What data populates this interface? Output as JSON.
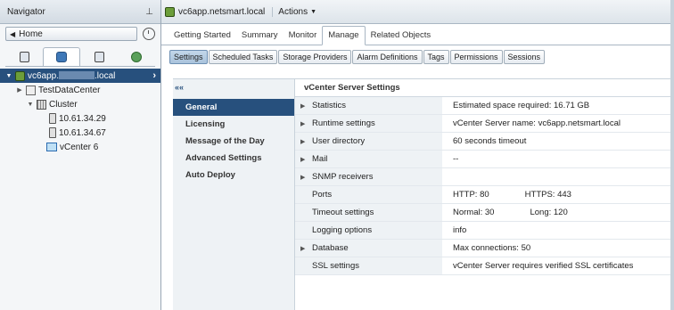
{
  "navigator": {
    "title": "Navigator",
    "home_label": "Home",
    "tree": [
      {
        "label": "vc6app.",
        "suffix": ".local",
        "selected": true
      },
      {
        "label": "TestDataCenter"
      },
      {
        "label": "Cluster"
      },
      {
        "label": "10.61.34.29"
      },
      {
        "label": "10.61.34.67"
      },
      {
        "label": "vCenter 6"
      }
    ]
  },
  "object": {
    "title": "vc6app.netsmart.local",
    "actions_label": "Actions"
  },
  "tabs": [
    "Getting Started",
    "Summary",
    "Monitor",
    "Manage",
    "Related Objects"
  ],
  "subtabs": [
    "Settings",
    "Scheduled Tasks",
    "Storage Providers",
    "Alarm Definitions",
    "Tags",
    "Permissions",
    "Sessions"
  ],
  "side_menu": {
    "collapse_label": "««",
    "items": [
      "General",
      "Licensing",
      "Message of the Day",
      "Advanced Settings",
      "Auto Deploy"
    ]
  },
  "settings": {
    "title": "vCenter Server Settings",
    "rows": [
      {
        "name": "Statistics",
        "expandable": true,
        "value": "Estimated space required: 16.71 GB",
        "value2": ""
      },
      {
        "name": "Runtime settings",
        "expandable": true,
        "value": "vCenter Server name: vc6app.netsmart.local",
        "value2": ""
      },
      {
        "name": "User directory",
        "expandable": true,
        "value": "60 seconds timeout",
        "value2": ""
      },
      {
        "name": "Mail",
        "expandable": true,
        "value": "--",
        "value2": ""
      },
      {
        "name": "SNMP receivers",
        "expandable": true,
        "value": "",
        "value2": ""
      },
      {
        "name": "Ports",
        "expandable": false,
        "value": "HTTP: 80",
        "value2": "HTTPS: 443"
      },
      {
        "name": "Timeout settings",
        "expandable": false,
        "value": "Normal: 30",
        "value2": "Long: 120"
      },
      {
        "name": "Logging options",
        "expandable": false,
        "value": "info",
        "value2": ""
      },
      {
        "name": "Database",
        "expandable": true,
        "value": "Max connections: 50",
        "value2": ""
      },
      {
        "name": "SSL settings",
        "expandable": false,
        "value": "vCenter Server requires verified SSL certificates",
        "value2": ""
      }
    ]
  },
  "colors": {
    "selection": "#27507d",
    "panel": "#eef2f5"
  }
}
